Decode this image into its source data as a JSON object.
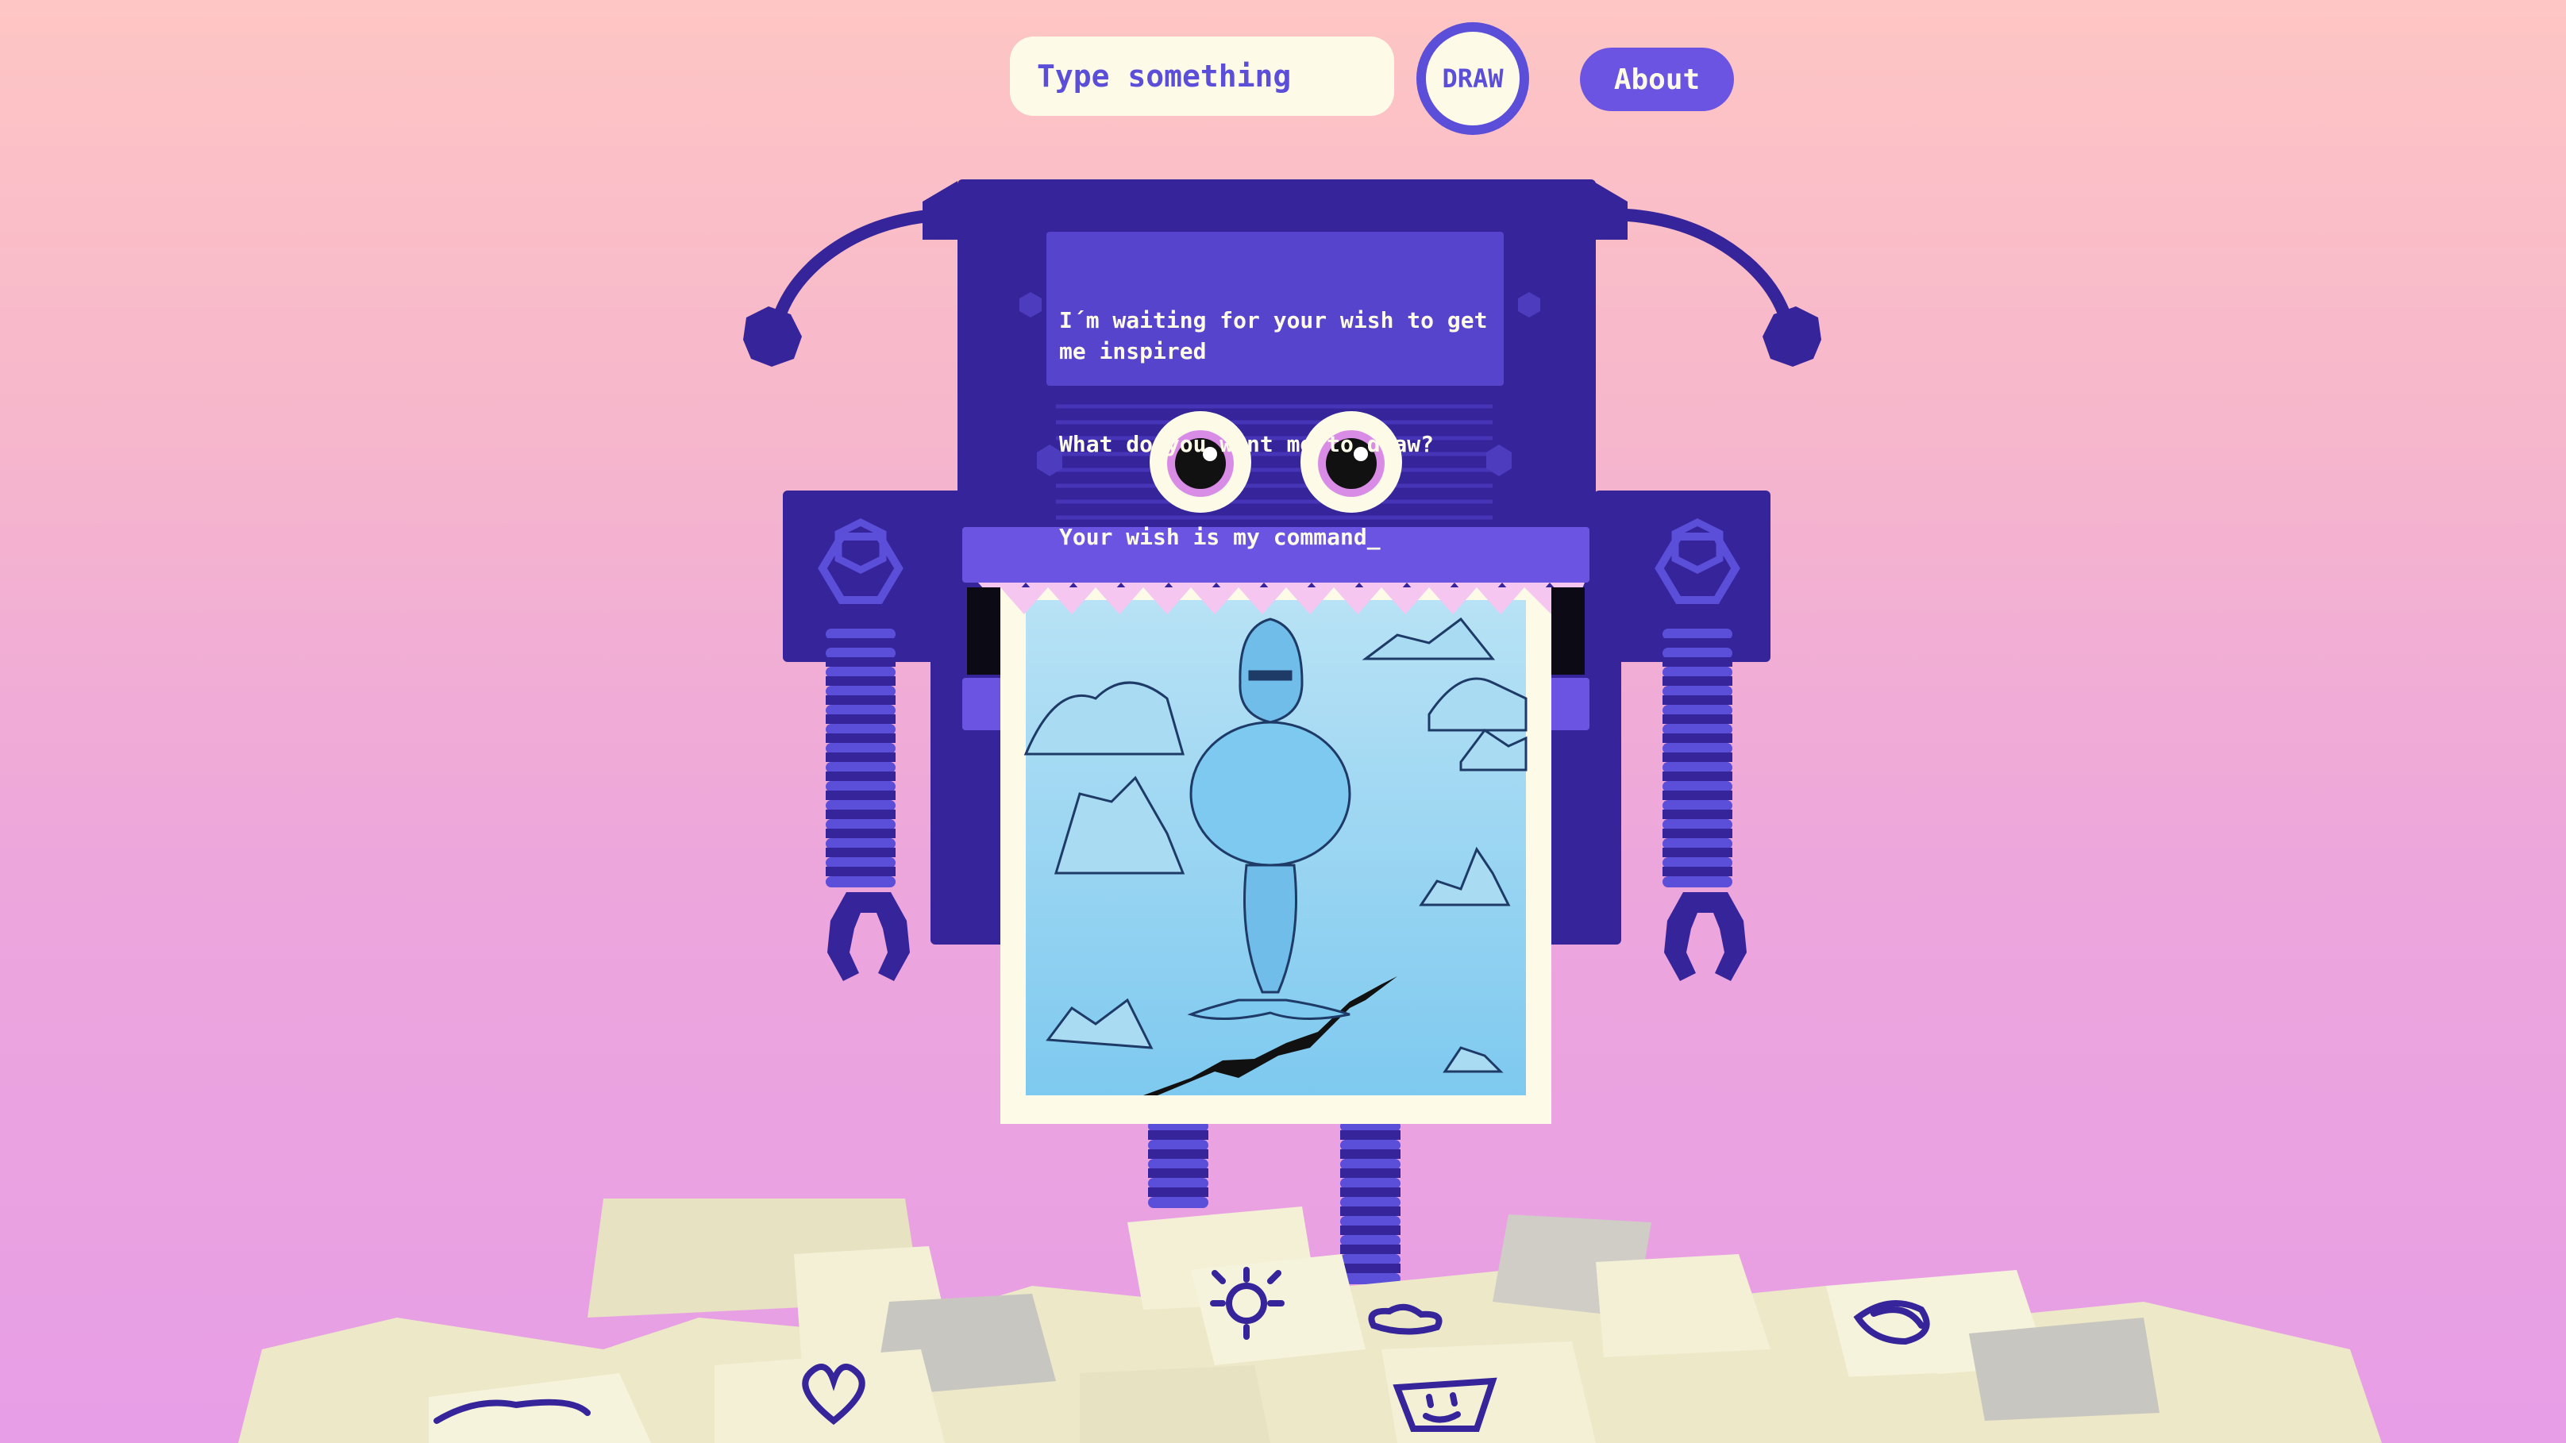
{
  "prompt": {
    "placeholder": "Type something",
    "value": ""
  },
  "buttons": {
    "draw_label": "DRAW",
    "about_label": "About"
  },
  "robot": {
    "screen_lines": [
      "I´m waiting for your wish to get me inspired",
      "What do you want me to draw?",
      "Your wish is my command_"
    ]
  },
  "drawing": {
    "subject": "gorilla-mermaid-on-ice"
  },
  "icons": {
    "draw": "draw-button-circle",
    "scribbles": [
      "sun-icon",
      "heart-icon",
      "smiley-icon",
      "scribble-icon",
      "cloud-icon",
      "squiggle-icon"
    ]
  },
  "colors": {
    "robot": "#36249a",
    "accent": "#6b54e2",
    "paper": "#fdfbe8",
    "drawing": "#7dc6ee",
    "background_top": "#fec6c4",
    "background_bottom": "#e79ee6"
  }
}
